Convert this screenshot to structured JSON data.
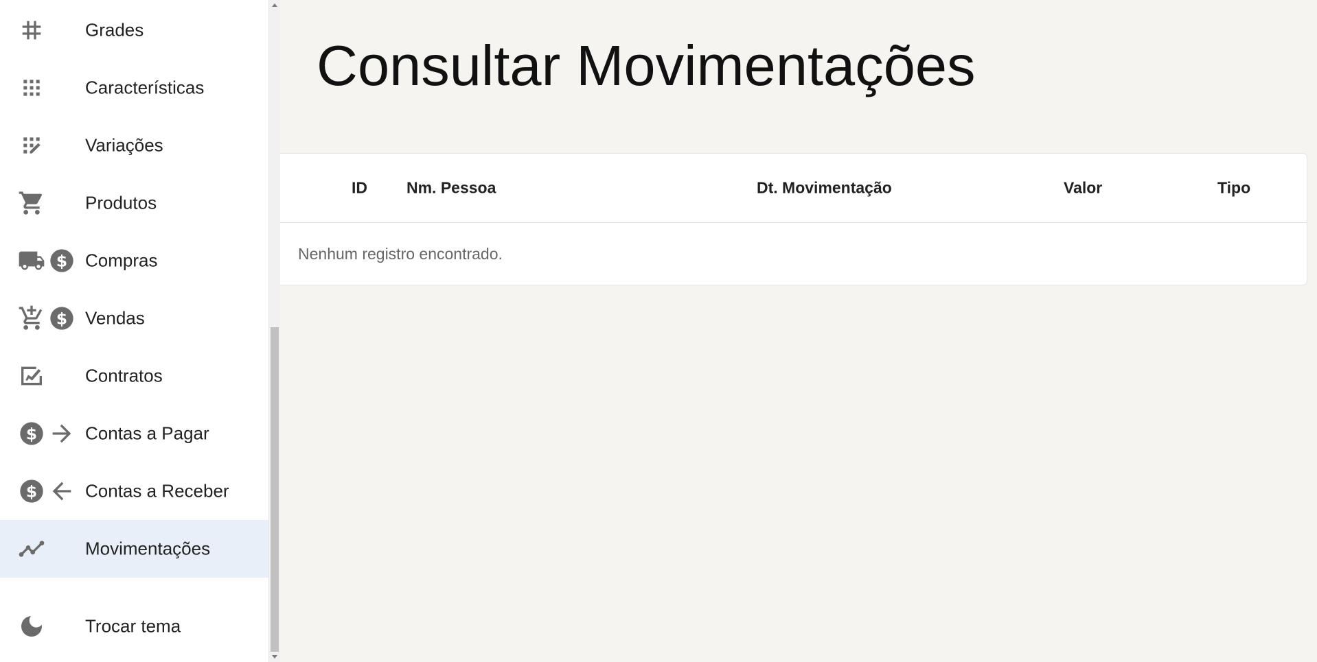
{
  "sidebar": {
    "items": [
      {
        "label": "Grades",
        "icons": [
          "hash-icon"
        ]
      },
      {
        "label": "Características",
        "icons": [
          "grid-dots-icon"
        ]
      },
      {
        "label": "Variações",
        "icons": [
          "grid-edit-icon"
        ]
      },
      {
        "label": "Produtos",
        "icons": [
          "cart-icon"
        ]
      },
      {
        "label": "Compras",
        "icons": [
          "truck-icon",
          "dollar-circle-icon"
        ]
      },
      {
        "label": "Vendas",
        "icons": [
          "add-cart-icon",
          "dollar-circle-icon"
        ]
      },
      {
        "label": "Contratos",
        "icons": [
          "contract-icon"
        ]
      },
      {
        "label": "Contas a Pagar",
        "icons": [
          "dollar-circle-icon",
          "arrow-right-icon"
        ]
      },
      {
        "label": "Contas a Receber",
        "icons": [
          "dollar-circle-icon",
          "arrow-left-icon"
        ]
      },
      {
        "label": "Movimentações",
        "icons": [
          "line-chart-icon"
        ],
        "active": true
      }
    ],
    "theme_toggle": {
      "label": "Trocar tema",
      "icon": "moon-icon"
    }
  },
  "main": {
    "title": "Consultar Movimentações",
    "table": {
      "columns": [
        "ID",
        "Nm. Pessoa",
        "Dt. Movimentação",
        "Valor",
        "Tipo"
      ],
      "rows": [],
      "empty_message": "Nenhum registro encontrado."
    }
  },
  "colors": {
    "page_bg": "#f5f4f1",
    "sidebar_bg": "#ffffff",
    "active_item_bg": "#e9eff8",
    "icon_gray": "#6b6b6b"
  }
}
